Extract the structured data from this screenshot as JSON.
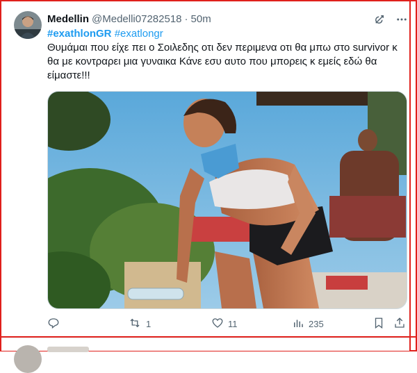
{
  "tweet": {
    "display_name": "Medellin",
    "handle": "@Medelli07282518",
    "separator": "·",
    "time": "50m",
    "hashtags": [
      "#exathlonGR",
      "#exatlongr"
    ],
    "text_lines": [
      "Θυμάμαι που είχε πει ο Σοιλεδης οτι δεν περιμενα οτι θα μπω στο survivor κ",
      "θα με κοντραρει μια γυναικα Κάνε εσυ αυτο που μπορεις κ εμείς εδώ θα",
      "είμαστε!!!"
    ]
  },
  "actions": {
    "replies": "",
    "retweets": "1",
    "likes": "11",
    "views": "235"
  },
  "icons": {
    "header": [
      "grok-icon",
      "more-icon"
    ],
    "actions": [
      "reply-icon",
      "retweet-icon",
      "like-icon",
      "views-icon",
      "bookmark-icon",
      "share-icon"
    ]
  },
  "colors": {
    "accent": "#1d9bf0",
    "text": "#0f1419",
    "muted": "#536471",
    "frame": "#e0201c"
  }
}
